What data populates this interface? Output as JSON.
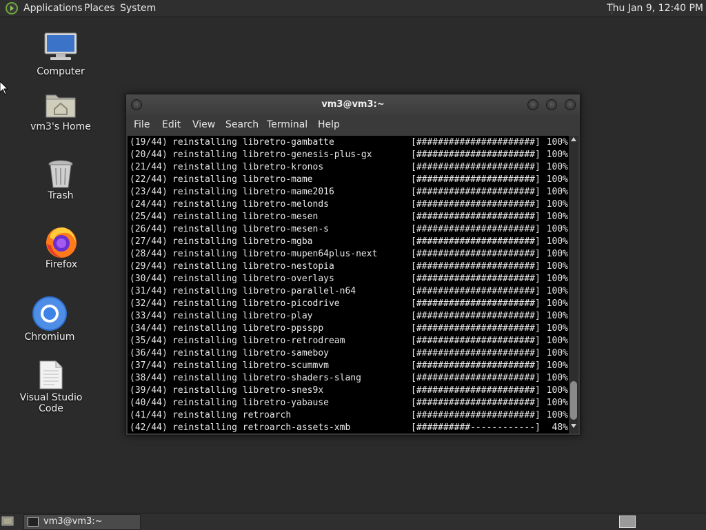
{
  "top_panel": {
    "menu": [
      "Applications",
      "Places",
      "System"
    ],
    "clock": "Thu Jan  9, 12:40 PM"
  },
  "desktop_icons": [
    {
      "label": "Computer",
      "icon": "computer-icon"
    },
    {
      "label": "vm3's Home",
      "icon": "home-folder-icon"
    },
    {
      "label": "Trash",
      "icon": "trash-icon"
    },
    {
      "label": "Firefox",
      "icon": "firefox-icon"
    },
    {
      "label": "Chromium",
      "icon": "chromium-icon"
    },
    {
      "label": "Visual Studio Code",
      "icon": "document-icon"
    }
  ],
  "terminal": {
    "title": "vm3@vm3:~",
    "menu": [
      "File",
      "Edit",
      "View",
      "Search",
      "Terminal",
      "Help"
    ],
    "lines": [
      {
        "step": "(19/44)",
        "text": "reinstalling libretro-gambatte",
        "bar": "[######################]",
        "pct": "100%"
      },
      {
        "step": "(20/44)",
        "text": "reinstalling libretro-genesis-plus-gx",
        "bar": "[######################]",
        "pct": "100%"
      },
      {
        "step": "(21/44)",
        "text": "reinstalling libretro-kronos",
        "bar": "[######################]",
        "pct": "100%"
      },
      {
        "step": "(22/44)",
        "text": "reinstalling libretro-mame",
        "bar": "[######################]",
        "pct": "100%"
      },
      {
        "step": "(23/44)",
        "text": "reinstalling libretro-mame2016",
        "bar": "[######################]",
        "pct": "100%"
      },
      {
        "step": "(24/44)",
        "text": "reinstalling libretro-melonds",
        "bar": "[######################]",
        "pct": "100%"
      },
      {
        "step": "(25/44)",
        "text": "reinstalling libretro-mesen",
        "bar": "[######################]",
        "pct": "100%"
      },
      {
        "step": "(26/44)",
        "text": "reinstalling libretro-mesen-s",
        "bar": "[######################]",
        "pct": "100%"
      },
      {
        "step": "(27/44)",
        "text": "reinstalling libretro-mgba",
        "bar": "[######################]",
        "pct": "100%"
      },
      {
        "step": "(28/44)",
        "text": "reinstalling libretro-mupen64plus-next",
        "bar": "[######################]",
        "pct": "100%"
      },
      {
        "step": "(29/44)",
        "text": "reinstalling libretro-nestopia",
        "bar": "[######################]",
        "pct": "100%"
      },
      {
        "step": "(30/44)",
        "text": "reinstalling libretro-overlays",
        "bar": "[######################]",
        "pct": "100%"
      },
      {
        "step": "(31/44)",
        "text": "reinstalling libretro-parallel-n64",
        "bar": "[######################]",
        "pct": "100%"
      },
      {
        "step": "(32/44)",
        "text": "reinstalling libretro-picodrive",
        "bar": "[######################]",
        "pct": "100%"
      },
      {
        "step": "(33/44)",
        "text": "reinstalling libretro-play",
        "bar": "[######################]",
        "pct": "100%"
      },
      {
        "step": "(34/44)",
        "text": "reinstalling libretro-ppsspp",
        "bar": "[######################]",
        "pct": "100%"
      },
      {
        "step": "(35/44)",
        "text": "reinstalling libretro-retrodream",
        "bar": "[######################]",
        "pct": "100%"
      },
      {
        "step": "(36/44)",
        "text": "reinstalling libretro-sameboy",
        "bar": "[######################]",
        "pct": "100%"
      },
      {
        "step": "(37/44)",
        "text": "reinstalling libretro-scummvm",
        "bar": "[######################]",
        "pct": "100%"
      },
      {
        "step": "(38/44)",
        "text": "reinstalling libretro-shaders-slang",
        "bar": "[######################]",
        "pct": "100%"
      },
      {
        "step": "(39/44)",
        "text": "reinstalling libretro-snes9x",
        "bar": "[######################]",
        "pct": "100%"
      },
      {
        "step": "(40/44)",
        "text": "reinstalling libretro-yabause",
        "bar": "[######################]",
        "pct": "100%"
      },
      {
        "step": "(41/44)",
        "text": "reinstalling retroarch",
        "bar": "[######################]",
        "pct": "100%"
      },
      {
        "step": "(42/44)",
        "text": "reinstalling retroarch-assets-xmb",
        "bar": "[##########------------]",
        "pct": "48%"
      }
    ]
  },
  "taskbar": {
    "task_label": "vm3@vm3:~"
  }
}
